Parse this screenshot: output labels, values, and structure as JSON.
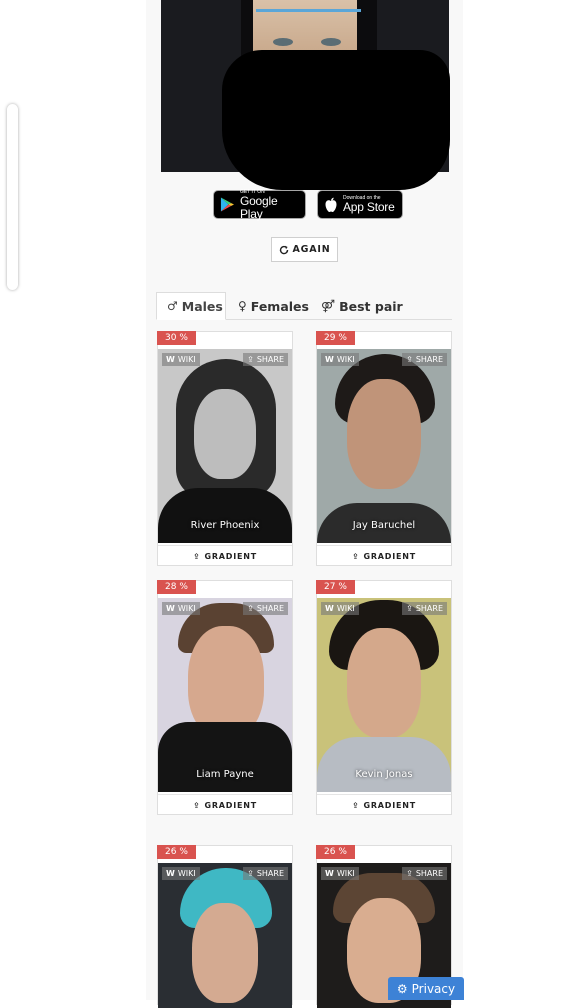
{
  "store_badges": {
    "google_small": "GET IT ON",
    "google_big": "Google Play",
    "apple_small": "Download on the",
    "apple_big": "App Store"
  },
  "again_label": "AGAIN",
  "tabs": [
    {
      "label": "Males",
      "icon": "male-icon",
      "active": true
    },
    {
      "label": "Females",
      "icon": "female-icon",
      "active": false
    },
    {
      "label": "Best pair",
      "icon": "couple-icon",
      "active": false
    }
  ],
  "card_labels": {
    "wiki": "WIKI",
    "share": "SHARE",
    "gradient": "GRADIENT"
  },
  "results": [
    {
      "percent": "30 %",
      "name": "River Phoenix"
    },
    {
      "percent": "29 %",
      "name": "Jay Baruchel"
    },
    {
      "percent": "28 %",
      "name": "Liam Payne"
    },
    {
      "percent": "27 %",
      "name": "Kevin Jonas"
    },
    {
      "percent": "26 %",
      "name": ""
    },
    {
      "percent": "26 %",
      "name": ""
    }
  ],
  "privacy_label": "Privacy",
  "colors": {
    "percent_badge": "#d9534f",
    "privacy_button": "#3d82d6",
    "accent_line": "#5aa6d8"
  }
}
